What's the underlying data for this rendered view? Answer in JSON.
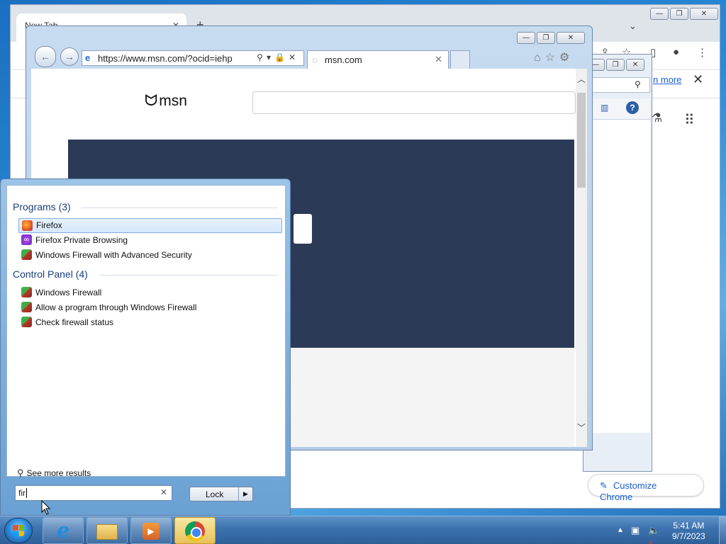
{
  "chrome": {
    "tab_title": "New Tab",
    "learn_more": "n more",
    "customize_label": "Customize Chrome"
  },
  "ie": {
    "address": "https://www.msn.com/?ocid=iehp",
    "tab_title": "msn.com",
    "msn_label": "msn"
  },
  "start_menu": {
    "programs_header": "Programs (3)",
    "programs": [
      {
        "label": "Firefox",
        "icon": "firefox-icon"
      },
      {
        "label": "Firefox Private Browsing",
        "icon": "firefox-private-icon"
      },
      {
        "label": "Windows Firewall with Advanced Security",
        "icon": "firewall-icon"
      }
    ],
    "control_panel_header": "Control Panel (4)",
    "control_panel": [
      {
        "label": "Windows Firewall",
        "icon": "firewall-icon"
      },
      {
        "label": "Allow a program through Windows Firewall",
        "icon": "firewall-icon"
      },
      {
        "label": "Check firewall status",
        "icon": "firewall-icon"
      }
    ],
    "see_more": "See more results",
    "search_value": "fir",
    "lock_label": "Lock"
  },
  "taskbar": {
    "time": "5:41 AM",
    "date": "9/7/2023"
  },
  "colors": {
    "taskbar": "#3f74b0",
    "msn_banner": "#2b3a56",
    "link": "#1a5fcc"
  }
}
